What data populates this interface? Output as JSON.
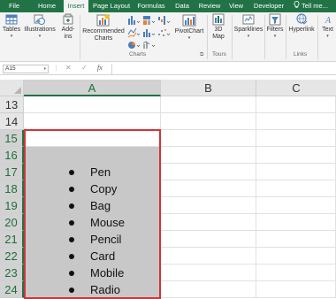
{
  "ribbon_tabs": [
    {
      "label": "File",
      "active": false
    },
    {
      "label": "Home",
      "active": false
    },
    {
      "label": "Insert",
      "active": true
    },
    {
      "label": "Page Layout",
      "active": false
    },
    {
      "label": "Formulas",
      "active": false
    },
    {
      "label": "Data",
      "active": false
    },
    {
      "label": "Review",
      "active": false
    },
    {
      "label": "View",
      "active": false
    },
    {
      "label": "Developer",
      "active": false
    }
  ],
  "tell_me": "Tell me...",
  "ribbon": {
    "tables": "Tables",
    "illustrations": "Illustrations",
    "addins": "Add-",
    "addins2": "ins",
    "recommended_charts": "Recommended",
    "recommended_charts2": "Charts",
    "pivotchart": "PivotChart",
    "map3d": "3D",
    "map3d2": "Map",
    "sparklines": "Sparklines",
    "filters": "Filters",
    "hyperlink": "Hyperlink",
    "text": "Text",
    "group_charts": "Charts",
    "group_tours": "Tours",
    "group_links": "Links"
  },
  "formula_bar": {
    "name_box": "A15",
    "cancel_symbol": "✕",
    "enter_symbol": "✓",
    "function_symbol": "fx",
    "value": ""
  },
  "columns": [
    "A",
    "B",
    "C"
  ],
  "rows": [
    "13",
    "14",
    "15",
    "16",
    "17",
    "18",
    "19",
    "20",
    "21",
    "22",
    "23",
    "24"
  ],
  "bullet_items": [
    "Pen",
    "Copy",
    "Bag",
    "Mouse",
    "Pencil",
    "Card",
    "Mobile",
    "Radio"
  ],
  "colors": {
    "excel_green": "#217346",
    "selection_fill": "#c8c8c8",
    "selection_border": "#d13438"
  }
}
